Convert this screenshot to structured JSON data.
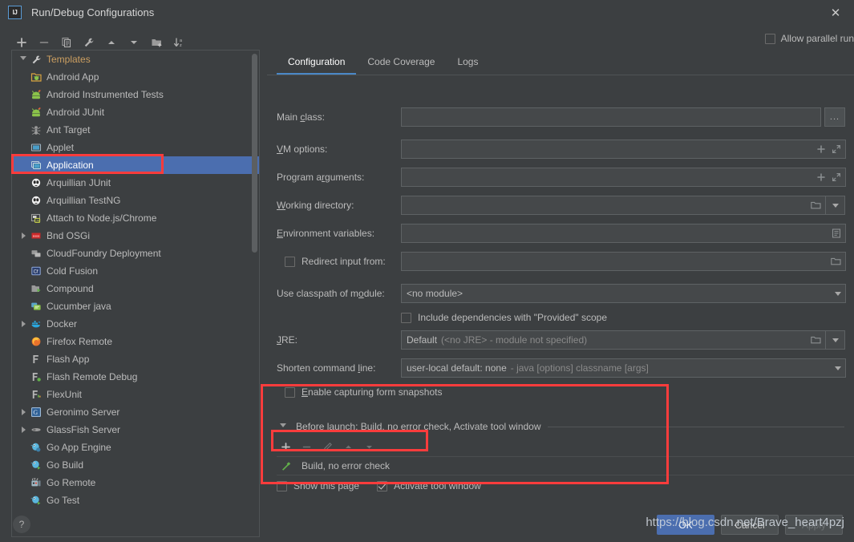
{
  "window": {
    "title": "Run/Debug Configurations",
    "logo_text": "IJ",
    "close_icon": "close-icon"
  },
  "tree_toolbar": [
    {
      "name": "add-configuration-button",
      "icon": "plus-icon"
    },
    {
      "name": "remove-configuration-button",
      "icon": "minus-icon"
    },
    {
      "name": "copy-configuration-button",
      "icon": "copy-icon"
    },
    {
      "name": "edit-templates-button",
      "icon": "wrench-icon"
    },
    {
      "name": "move-up-button",
      "icon": "arrow-up-icon"
    },
    {
      "name": "move-down-button",
      "icon": "arrow-down-icon"
    },
    {
      "name": "move-into-folder-button",
      "icon": "folder-add-icon"
    },
    {
      "name": "sort-configurations-button",
      "icon": "sort-az-icon"
    }
  ],
  "tree": {
    "root": {
      "label": "Templates",
      "icon": "wrench-icon",
      "expanded": true
    },
    "items": [
      {
        "label": "Android App",
        "icon": "android-app-icon",
        "indent": 1,
        "expandable": false,
        "selected": false
      },
      {
        "label": "Android Instrumented Tests",
        "icon": "android-icon",
        "indent": 1,
        "expandable": false,
        "selected": false
      },
      {
        "label": "Android JUnit",
        "icon": "android-icon",
        "indent": 1,
        "expandable": false,
        "selected": false
      },
      {
        "label": "Ant Target",
        "icon": "ant-icon",
        "indent": 1,
        "expandable": false,
        "selected": false
      },
      {
        "label": "Applet",
        "icon": "applet-icon",
        "indent": 1,
        "expandable": false,
        "selected": false
      },
      {
        "label": "Application",
        "icon": "application-icon",
        "indent": 1,
        "expandable": false,
        "selected": true
      },
      {
        "label": "Arquillian JUnit",
        "icon": "arquillian-icon",
        "indent": 1,
        "expandable": false,
        "selected": false
      },
      {
        "label": "Arquillian TestNG",
        "icon": "arquillian-icon",
        "indent": 1,
        "expandable": false,
        "selected": false
      },
      {
        "label": "Attach to Node.js/Chrome",
        "icon": "nodejs-attach-icon",
        "indent": 1,
        "expandable": false,
        "selected": false
      },
      {
        "label": "Bnd OSGi",
        "icon": "bnd-osgi-icon",
        "indent": 1,
        "expandable": true,
        "selected": false
      },
      {
        "label": "CloudFoundry Deployment",
        "icon": "cloudfoundry-icon",
        "indent": 1,
        "expandable": false,
        "selected": false
      },
      {
        "label": "Cold Fusion",
        "icon": "coldfusion-icon",
        "indent": 1,
        "expandable": false,
        "selected": false
      },
      {
        "label": "Compound",
        "icon": "compound-icon",
        "indent": 1,
        "expandable": false,
        "selected": false
      },
      {
        "label": "Cucumber java",
        "icon": "cucumber-icon",
        "indent": 1,
        "expandable": false,
        "selected": false
      },
      {
        "label": "Docker",
        "icon": "docker-icon",
        "indent": 1,
        "expandable": true,
        "selected": false
      },
      {
        "label": "Firefox Remote",
        "icon": "firefox-icon",
        "indent": 1,
        "expandable": false,
        "selected": false
      },
      {
        "label": "Flash App",
        "icon": "flash-icon",
        "indent": 1,
        "expandable": false,
        "selected": false
      },
      {
        "label": "Flash Remote Debug",
        "icon": "flash-debug-icon",
        "indent": 1,
        "expandable": false,
        "selected": false
      },
      {
        "label": "FlexUnit",
        "icon": "flexunit-icon",
        "indent": 1,
        "expandable": false,
        "selected": false
      },
      {
        "label": "Geronimo Server",
        "icon": "geronimo-icon",
        "indent": 1,
        "expandable": true,
        "selected": false
      },
      {
        "label": "GlassFish Server",
        "icon": "glassfish-icon",
        "indent": 1,
        "expandable": true,
        "selected": false
      },
      {
        "label": "Go App Engine",
        "icon": "go-icon",
        "indent": 1,
        "expandable": false,
        "selected": false
      },
      {
        "label": "Go Build",
        "icon": "go-icon",
        "indent": 1,
        "expandable": false,
        "selected": false
      },
      {
        "label": "Go Remote",
        "icon": "go-remote-icon",
        "indent": 1,
        "expandable": false,
        "selected": false
      },
      {
        "label": "Go Test",
        "icon": "go-icon",
        "indent": 1,
        "expandable": false,
        "selected": false
      }
    ]
  },
  "header": {
    "allow_parallel_run": {
      "label": "Allow parallel run",
      "checked": false
    }
  },
  "tabs": [
    {
      "label": "Configuration",
      "active": true
    },
    {
      "label": "Code Coverage",
      "active": false
    },
    {
      "label": "Logs",
      "active": false
    }
  ],
  "form": {
    "main_class": {
      "label_pre": "Main ",
      "label_mn": "c",
      "label_post": "lass:",
      "value": "",
      "browse_label": "..."
    },
    "vm_options": {
      "label_mn": "V",
      "label_post": "M options:",
      "value": ""
    },
    "program_arguments": {
      "label_pre": "Program a",
      "label_mn": "r",
      "label_post": "guments:",
      "value": ""
    },
    "working_directory": {
      "label_mn": "W",
      "label_post": "orking directory:",
      "value": ""
    },
    "environment_variables": {
      "label_mn": "E",
      "label_post": "nvironment variables:",
      "value": ""
    },
    "redirect_input": {
      "label_pre": "Redirect input from:",
      "checked": false,
      "value": ""
    },
    "use_classpath_of_module": {
      "label_pre": "Use classpath of m",
      "label_mn": "o",
      "label_post": "dule:",
      "value": "<no module>"
    },
    "include_provided_scope": {
      "label": "Include dependencies with \"Provided\" scope",
      "checked": false
    },
    "jre": {
      "label_mn": "J",
      "label_post": "RE:",
      "value_strong": "Default",
      "value_dim": "(<no JRE> - module not specified)"
    },
    "shorten_command_line": {
      "label_pre": "Shorten command ",
      "label_mn": "l",
      "label_post": "ine:",
      "value_strong": "user-local default: none",
      "value_dim": "- java [options] classname [args]"
    },
    "enable_capturing": {
      "label_pre": "",
      "label_mn": "E",
      "label_post": "nable capturing form snapshots",
      "checked": false
    }
  },
  "before_launch": {
    "title_mn": "B",
    "title_post": "efore launch: Build, no error check, Activate tool window",
    "expanded": true,
    "toolbar": [
      {
        "name": "add-task-button",
        "icon": "plus-icon",
        "enabled": true
      },
      {
        "name": "remove-task-button",
        "icon": "minus-icon",
        "enabled": false
      },
      {
        "name": "edit-task-button",
        "icon": "pencil-icon",
        "enabled": false
      },
      {
        "name": "task-move-up-button",
        "icon": "arrow-up-icon",
        "enabled": false
      },
      {
        "name": "task-move-down-button",
        "icon": "arrow-down-icon",
        "enabled": false
      }
    ],
    "tasks": [
      {
        "label": "Build, no error check",
        "icon": "build-hammer-icon"
      }
    ],
    "show_this_page": {
      "label": "Show this page",
      "checked": false
    },
    "activate_tool_window": {
      "label": "Activate tool window",
      "checked": true
    }
  },
  "footer": {
    "help_label": "?",
    "buttons": [
      {
        "label": "OK",
        "style": "primary"
      },
      {
        "label": "Cancel",
        "style": "normal"
      },
      {
        "label": "Apply",
        "style": "disabled"
      }
    ]
  },
  "watermark": {
    "text": "https://blog.csdn.net/Brave_heart4pzj"
  },
  "colors": {
    "background": "#3c3f41",
    "selection_blue": "#4b6eaf",
    "annotation_red": "#fc3c3c",
    "tab_accent": "#4a88c7",
    "root_label": "#cc9f61"
  }
}
